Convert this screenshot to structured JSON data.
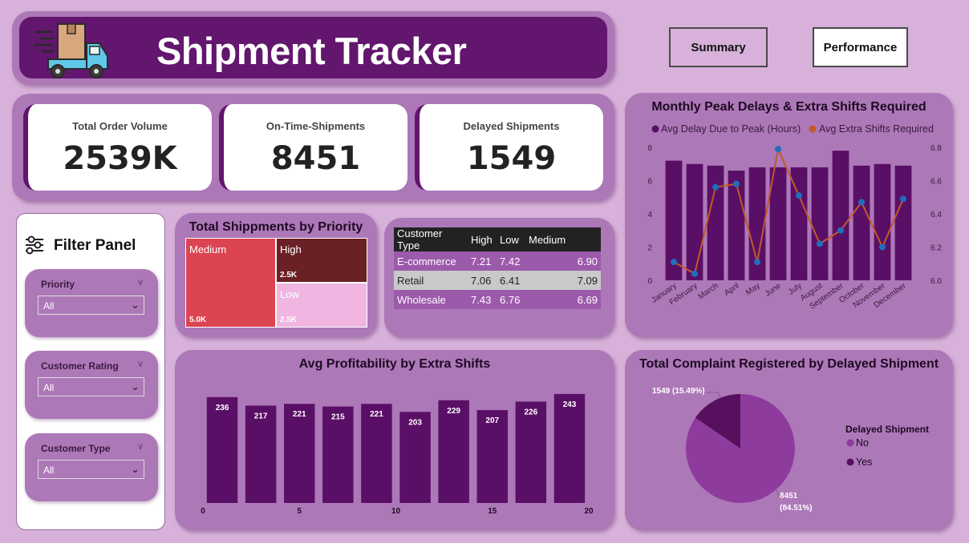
{
  "header": {
    "title": "Shipment Tracker",
    "logo_icon": "delivery-truck-icon"
  },
  "nav": {
    "summary": "Summary",
    "performance": "Performance"
  },
  "kpis": [
    {
      "label": "Total Order Volume",
      "value": "2539K"
    },
    {
      "label": "On-Time-Shipments",
      "value": "8451"
    },
    {
      "label": "Delayed Shipments",
      "value": "1549"
    }
  ],
  "filter_panel": {
    "title": "Filter Panel",
    "icon": "sliders-icon",
    "slicers": [
      {
        "label": "Priority",
        "value": "All"
      },
      {
        "label": "Customer Rating",
        "value": "All"
      },
      {
        "label": "Customer Type",
        "value": "All"
      }
    ]
  },
  "treemap": {
    "title": "Total Shippments by Priority",
    "tiles": [
      {
        "name": "Medium",
        "value_label": "5.0K",
        "color": "#dc4452"
      },
      {
        "name": "High",
        "value_label": "2.5K",
        "color": "#6a2025"
      },
      {
        "name": "Low",
        "value_label": "2.5K",
        "color": "#f0b5e0"
      }
    ]
  },
  "table": {
    "headers": [
      "Customer Type",
      "High",
      "Low",
      "Medium"
    ],
    "rows": [
      [
        "E-commerce",
        "7.21",
        "7.42",
        "6.90"
      ],
      [
        "Retail",
        "7.06",
        "6.41",
        "7.09"
      ],
      [
        "Wholesale",
        "7.43",
        "6.76",
        "6.69"
      ]
    ]
  },
  "monthly": {
    "title": "Monthly Peak Delays & Extra Shifts Required",
    "legend": [
      "Avg Delay Due to Peak (Hours)",
      "Avg Extra Shifts Required"
    ],
    "colors": {
      "bar": "#5a0f66",
      "line": "#c0592a",
      "dot": "#1f6fbf"
    }
  },
  "profit": {
    "title": "Avg Profitability by Extra Shifts",
    "bar_color": "#5a0f66"
  },
  "pie": {
    "title": "Total Complaint Registered by Delayed Shipment",
    "legend_title": "Delayed Shipment",
    "legend": [
      {
        "name": "No",
        "color": "#8e3b9e"
      },
      {
        "name": "Yes",
        "color": "#57105e"
      }
    ],
    "label_yes": "1549 (15.49%)",
    "label_no_value": "8451",
    "label_no_pct": "(84.51%)"
  },
  "chart_data": [
    {
      "type": "bar",
      "title": "Monthly Peak Delays & Extra Shifts Required",
      "categories": [
        "January",
        "February",
        "March",
        "April",
        "May",
        "June",
        "July",
        "August",
        "September",
        "October",
        "November",
        "December"
      ],
      "series": [
        {
          "name": "Avg Delay Due to Peak (Hours)",
          "type": "bar",
          "axis": "left",
          "values": [
            7.2,
            7.0,
            6.9,
            6.6,
            6.8,
            6.8,
            6.8,
            6.8,
            7.8,
            6.9,
            7.0,
            6.9
          ]
        },
        {
          "name": "Avg Extra Shifts Required",
          "type": "line",
          "axis": "right",
          "values": [
            6.11,
            6.04,
            6.56,
            6.58,
            6.11,
            6.79,
            6.51,
            6.22,
            6.3,
            6.47,
            6.2,
            6.49
          ]
        }
      ],
      "yticks": [
        "0",
        "2",
        "4",
        "6",
        "8"
      ],
      "y2ticks": [
        "6.0",
        "6.2",
        "6.4",
        "6.6",
        "6.8"
      ],
      "ylim": [
        0,
        8
      ],
      "y2lim": [
        6.0,
        6.8
      ]
    },
    {
      "type": "bar",
      "title": "Avg Profitability by Extra Shifts",
      "x": [
        1,
        3,
        5,
        7,
        9,
        11,
        13,
        15,
        17,
        19
      ],
      "values": [
        236,
        217,
        221,
        215,
        221,
        203,
        229,
        207,
        226,
        243
      ],
      "xticks": [
        "0",
        "5",
        "10",
        "15",
        "20"
      ],
      "xlim": [
        0,
        20
      ],
      "ylim": [
        0,
        250
      ]
    },
    {
      "type": "pie",
      "title": "Total Complaint Registered by Delayed Shipment",
      "slices": [
        {
          "name": "No",
          "value": 8451
        },
        {
          "name": "Yes",
          "value": 1549
        }
      ]
    }
  ]
}
